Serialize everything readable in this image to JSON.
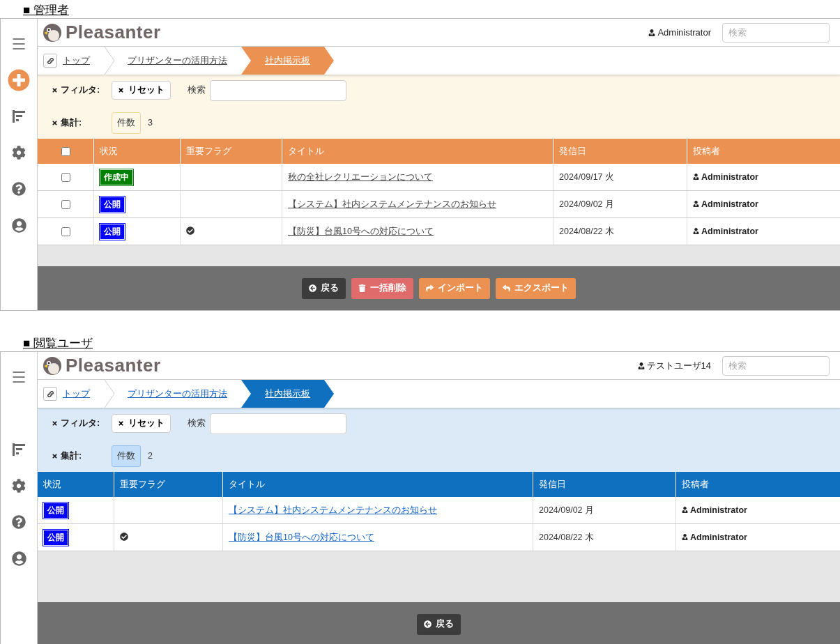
{
  "panels": [
    {
      "kind": "admin",
      "caption": "■ 管理者",
      "sidebar": [
        {
          "kind": "menu"
        },
        {
          "kind": "add"
        },
        {
          "kind": "sort"
        },
        {
          "kind": "settings"
        },
        {
          "kind": "help"
        },
        {
          "kind": "account"
        }
      ],
      "header": {
        "logo": "Pleasanter",
        "user": "Administrator",
        "search_placeholder": "検索"
      },
      "breadcrumb": [
        {
          "label": "トップ",
          "selected": false
        },
        {
          "label": "プリザンターの活用方法",
          "selected": false
        },
        {
          "label": "社内掲示板",
          "selected": true
        }
      ],
      "filter": {
        "label": "フィルタ:",
        "reset": "リセット",
        "search_label": "検索",
        "aggregate_label": "集計:",
        "aggregate_chip": "件数",
        "aggregate_value": "3"
      },
      "table": {
        "selectable": true,
        "header_checked": false,
        "columns": [
          "状況",
          "重要フラグ",
          "タイトル",
          "発信日",
          "投稿者"
        ],
        "rows": [
          {
            "checked": false,
            "status": {
              "label": "作成中",
              "color": "#008000"
            },
            "flagged": false,
            "title": "秋の全社レクリエーションについて",
            "date": "2024/09/17 火",
            "author": "Administrator"
          },
          {
            "checked": false,
            "status": {
              "label": "公開",
              "color": "#0000ff"
            },
            "flagged": false,
            "title": "【システム】社内システムメンテナンスのお知らせ",
            "date": "2024/09/02 月",
            "author": "Administrator"
          },
          {
            "checked": false,
            "status": {
              "label": "公開",
              "color": "#0000ff"
            },
            "flagged": true,
            "title": "【防災】台風10号への対応について",
            "date": "2024/08/22 木",
            "author": "Administrator"
          }
        ]
      },
      "buttons": [
        {
          "kind": "back",
          "label": "戻る"
        },
        {
          "kind": "delete",
          "label": "一括削除"
        },
        {
          "kind": "import",
          "label": "インポート"
        },
        {
          "kind": "export",
          "label": "エクスポート"
        }
      ]
    },
    {
      "kind": "viewer",
      "caption": "■ 閲覧ユーザ",
      "sidebar": [
        {
          "kind": "menu"
        },
        {
          "kind": "sort"
        },
        {
          "kind": "settings"
        },
        {
          "kind": "help"
        },
        {
          "kind": "account"
        }
      ],
      "header": {
        "logo": "Pleasanter",
        "user": "テストユーザ14",
        "search_placeholder": "検索"
      },
      "breadcrumb": [
        {
          "label": "トップ",
          "selected": false
        },
        {
          "label": "プリザンターの活用方法",
          "selected": false
        },
        {
          "label": "社内掲示板",
          "selected": true
        }
      ],
      "filter": {
        "label": "フィルタ:",
        "reset": "リセット",
        "search_label": "検索",
        "aggregate_label": "集計:",
        "aggregate_chip": "件数",
        "aggregate_value": "2"
      },
      "table": {
        "selectable": false,
        "columns": [
          "状況",
          "重要フラグ",
          "タイトル",
          "発信日",
          "投稿者"
        ],
        "rows": [
          {
            "status": {
              "label": "公開",
              "color": "#0000ff"
            },
            "flagged": false,
            "title": "【システム】社内システムメンテナンスのお知らせ",
            "date": "2024/09/02 月",
            "author": "Administrator"
          },
          {
            "status": {
              "label": "公開",
              "color": "#0000ff"
            },
            "flagged": true,
            "title": "【防災】台風10号への対応について",
            "date": "2024/08/22 木",
            "author": "Administrator"
          }
        ]
      },
      "buttons": [
        {
          "kind": "back",
          "label": "戻る"
        }
      ]
    }
  ]
}
